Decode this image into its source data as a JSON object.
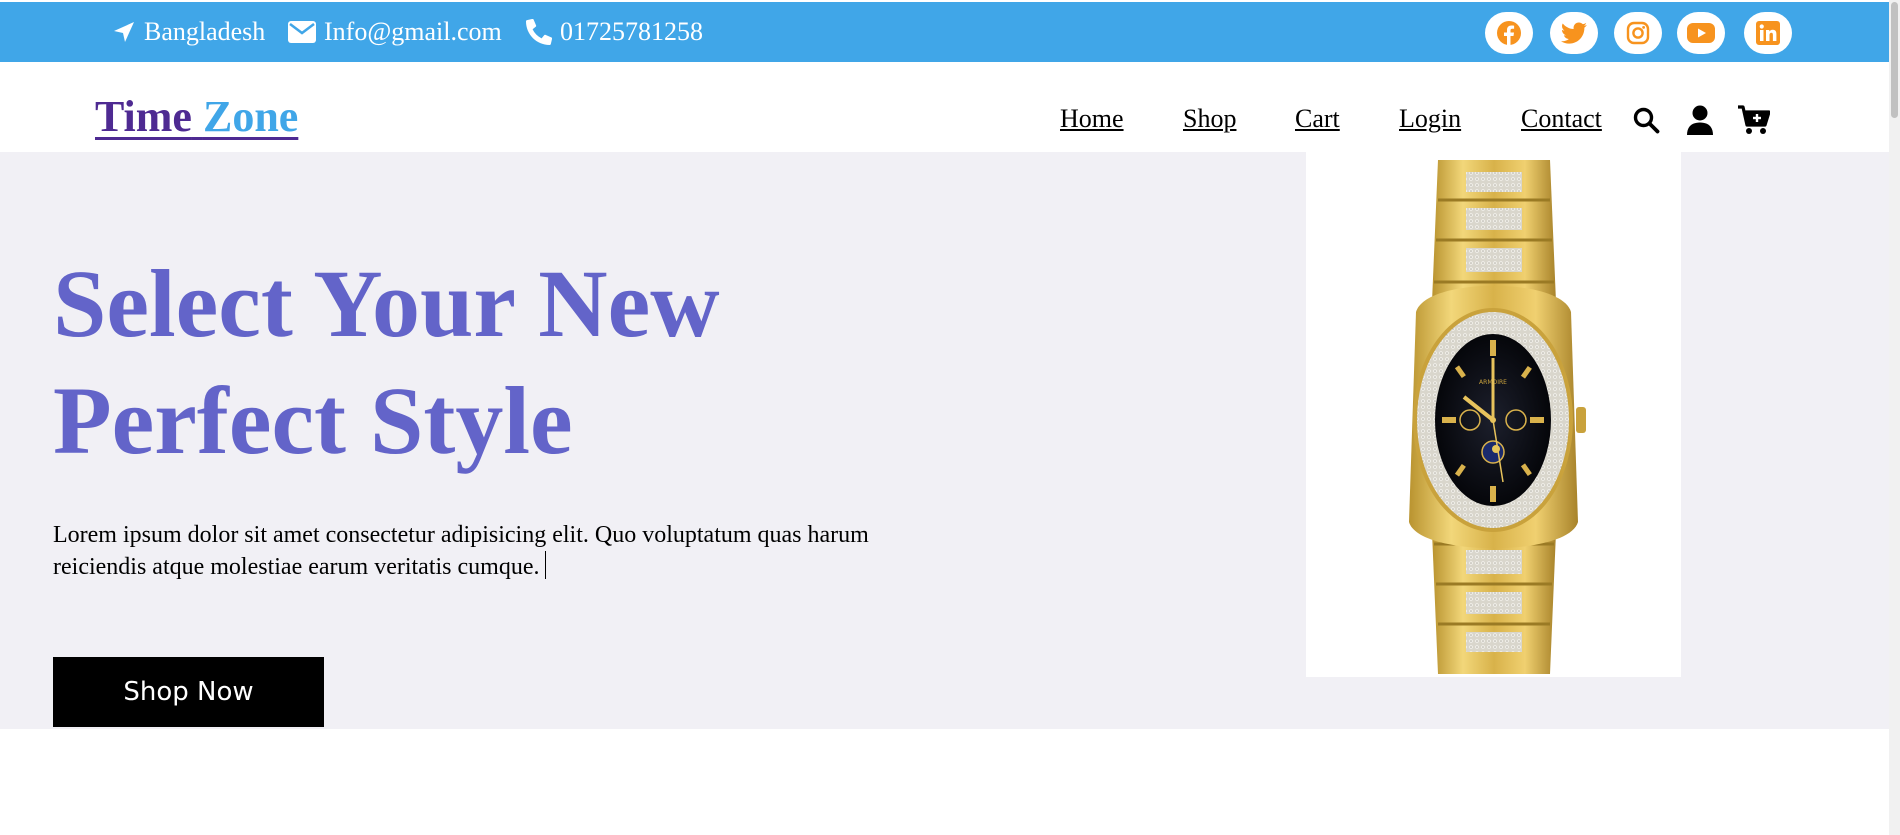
{
  "topbar": {
    "location": "Bangladesh",
    "email": "Info@gmail.com",
    "phone": "01725781258",
    "social": [
      {
        "icon": "facebook-icon",
        "color": "#f7931e"
      },
      {
        "icon": "twitter-icon",
        "color": "#f7931e"
      },
      {
        "icon": "instagram-icon",
        "color": "#f7931e"
      },
      {
        "icon": "youtube-icon",
        "color": "#f7931e"
      },
      {
        "icon": "linkedin-icon",
        "color": "#f7931e"
      }
    ],
    "background": "#40a6e8"
  },
  "nav": {
    "logo_word1": "Time",
    "logo_word2": "Zone",
    "logo_colors": {
      "word1": "#4e2a92",
      "word2": "#40a6e8"
    },
    "links": [
      "Home",
      "Shop",
      "Cart",
      "Login",
      "Contact"
    ],
    "icons": [
      "search-icon",
      "user-icon",
      "cart-plus-icon"
    ]
  },
  "hero": {
    "title_line1": "Select Your New",
    "title_line2": "Perfect Style",
    "title_color": "#6364c9",
    "text": "Lorem ipsum dolor sit amet consectetur adipisicing elit. Quo voluptatum quas harum reiciendis atque molestiae earum veritatis cumque.",
    "button_label": "Shop Now",
    "image": "gold-diamond-watch"
  }
}
